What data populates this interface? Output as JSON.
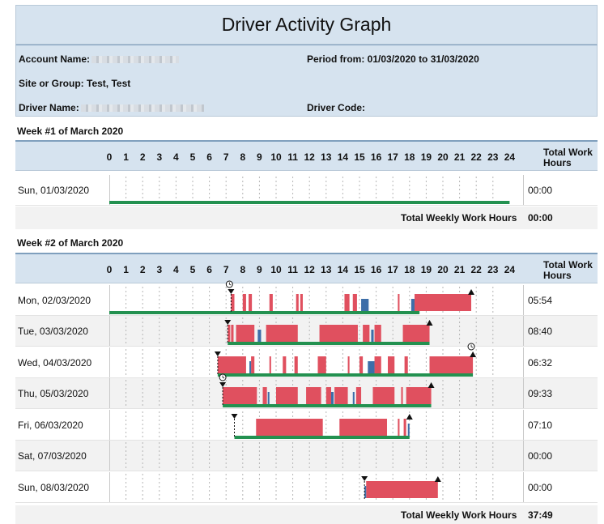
{
  "report": {
    "title": "Driver Activity Graph",
    "account_label": "Account Name:",
    "period_label": "Period from: 01/03/2020 to 31/03/2020",
    "site_label": "Site or Group: Test, Test",
    "driver_name_label": "Driver Name:",
    "driver_code_label": "Driver Code:",
    "total_work_hours_header": "Total Work Hours",
    "total_weekly_label": "Total Weekly Work Hours"
  },
  "hours": [
    "0",
    "1",
    "2",
    "3",
    "4",
    "5",
    "6",
    "7",
    "8",
    "9",
    "10",
    "11",
    "12",
    "13",
    "14",
    "15",
    "16",
    "17",
    "18",
    "19",
    "20",
    "21",
    "22",
    "23",
    "24"
  ],
  "colors": {
    "drive": "#e0505f",
    "work": "#3d6ea8",
    "rest": "#239150",
    "header": "#d6e3ef"
  },
  "weeks": [
    {
      "title": "Week #1 of March 2020",
      "total": "00:00",
      "days": [
        {
          "date": "Sun, 01/03/2020",
          "hours": "00:00",
          "rest": [
            [
              0,
              24
            ]
          ],
          "drive": [],
          "work": [],
          "starts": [],
          "ends": [],
          "clocks": []
        }
      ]
    },
    {
      "title": "Week #2 of March 2020",
      "total": "37:49",
      "days": [
        {
          "date": "Mon, 02/03/2020",
          "hours": "05:54",
          "rest": [
            [
              0,
              18.6
            ]
          ],
          "drive": [
            [
              7.3,
              7.5
            ],
            [
              8.0,
              8.2
            ],
            [
              8.35,
              8.55
            ],
            [
              9.6,
              9.8
            ],
            [
              11.2,
              11.35
            ],
            [
              11.45,
              11.6
            ],
            [
              14.1,
              14.4
            ],
            [
              14.6,
              14.85
            ],
            [
              17.3,
              17.4
            ],
            [
              18.3,
              21.7
            ]
          ],
          "work": [
            [
              15.1,
              15.55
            ],
            [
              18.1,
              18.3
            ]
          ],
          "starts": [
            7.3
          ],
          "ends": [
            21.7
          ],
          "clocks": [
            7.2
          ]
        },
        {
          "date": "Tue, 03/03/2020",
          "hours": "08:40",
          "rest": [
            [
              7.1,
              19.2
            ]
          ],
          "drive": [
            [
              7.1,
              7.25
            ],
            [
              7.3,
              7.45
            ],
            [
              7.6,
              8.7
            ],
            [
              9.4,
              11.3
            ],
            [
              12.6,
              14.9
            ],
            [
              15.2,
              15.6
            ],
            [
              15.9,
              16.3
            ],
            [
              17.6,
              19.2
            ]
          ],
          "work": [
            [
              8.9,
              9.1
            ],
            [
              15.7,
              15.85
            ]
          ],
          "starts": [
            7.1
          ],
          "ends": [
            19.2
          ],
          "clocks": []
        },
        {
          "date": "Wed, 04/03/2020",
          "hours": "06:32",
          "rest": [
            [
              6.5,
              21.8
            ]
          ],
          "drive": [
            [
              6.5,
              8.2
            ],
            [
              8.5,
              8.7
            ],
            [
              9.6,
              9.7
            ],
            [
              10.4,
              10.6
            ],
            [
              11.1,
              11.3
            ],
            [
              12.5,
              13.0
            ],
            [
              14.3,
              14.4
            ],
            [
              15.0,
              15.2
            ],
            [
              15.9,
              16.3
            ],
            [
              16.7,
              17.1
            ],
            [
              17.7,
              17.9
            ],
            [
              19.2,
              21.8
            ]
          ],
          "work": [
            [
              8.4,
              8.5
            ],
            [
              15.5,
              15.9
            ]
          ],
          "starts": [
            6.5
          ],
          "ends": [
            21.8
          ],
          "clocks": [
            21.7
          ]
        },
        {
          "date": "Thu, 05/03/2020",
          "hours": "09:33",
          "rest": [
            [
              6.8,
              19.3
            ]
          ],
          "drive": [
            [
              6.8,
              8.85
            ],
            [
              9.2,
              9.45
            ],
            [
              10.0,
              11.3
            ],
            [
              11.8,
              12.7
            ],
            [
              13.0,
              13.3
            ],
            [
              13.5,
              14.3
            ],
            [
              14.8,
              15.1
            ],
            [
              15.8,
              17.1
            ],
            [
              17.5,
              17.6
            ],
            [
              17.8,
              19.3
            ]
          ],
          "work": [
            [
              9.5,
              9.6
            ],
            [
              13.3,
              13.45
            ],
            [
              14.6,
              14.7
            ]
          ],
          "starts": [
            6.8
          ],
          "ends": [
            19.3
          ],
          "clocks": [
            6.8
          ]
        },
        {
          "date": "Fri, 06/03/2020",
          "hours": "07:10",
          "rest": [
            [
              7.5,
              18.0
            ]
          ],
          "drive": [
            [
              8.8,
              12.8
            ],
            [
              13.8,
              16.65
            ],
            [
              17.3,
              17.4
            ],
            [
              17.65,
              17.8
            ]
          ],
          "work": [
            [
              17.9,
              18.0
            ]
          ],
          "starts": [
            7.5
          ],
          "ends": [
            18.0
          ],
          "clocks": []
        },
        {
          "date": "Sat, 07/03/2020",
          "hours": "00:00",
          "rest": [],
          "drive": [],
          "work": [],
          "starts": [],
          "ends": [],
          "clocks": []
        },
        {
          "date": "Sun, 08/03/2020",
          "hours": "00:00",
          "rest": [],
          "drive": [
            [
              15.4,
              19.7
            ]
          ],
          "work": [
            [
              15.3,
              15.4
            ]
          ],
          "starts": [
            15.3
          ],
          "ends": [
            19.7
          ],
          "clocks": []
        }
      ]
    }
  ]
}
